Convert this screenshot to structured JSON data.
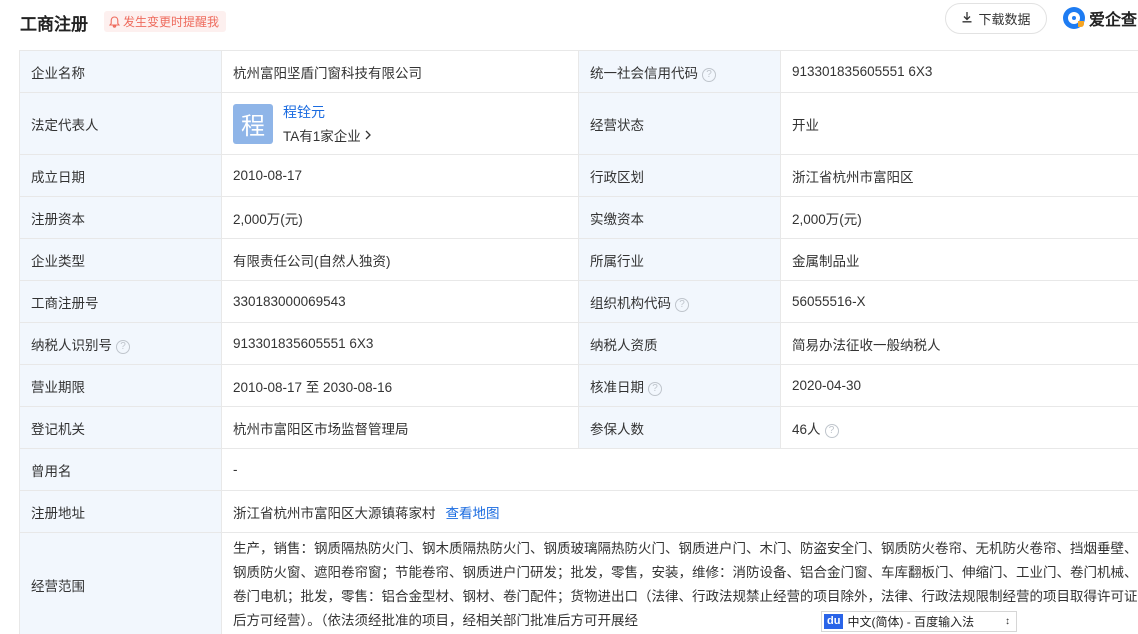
{
  "header": {
    "title": "工商注册",
    "alert_label": "发生变更时提醒我",
    "download_label": "下载数据",
    "brand": "爱企查"
  },
  "rows": {
    "r1": {
      "l1": "企业名称",
      "v1": "杭州富阳坚盾门窗科技有限公司",
      "l2": "统一社会信用代码",
      "v2": "913301835605551 6X3"
    },
    "r2": {
      "l1": "法定代表人",
      "rep_initial": "程",
      "rep_name": "程铨元",
      "rep_link": "TA有1家企业",
      "l2": "经营状态",
      "v2": "开业"
    },
    "r3": {
      "l1": "成立日期",
      "v1": "2010-08-17",
      "l2": "行政区划",
      "v2": "浙江省杭州市富阳区"
    },
    "r4": {
      "l1": "注册资本",
      "v1": "2,000万(元)",
      "l2": "实缴资本",
      "v2": "2,000万(元)"
    },
    "r5": {
      "l1": "企业类型",
      "v1": "有限责任公司(自然人独资)",
      "l2": "所属行业",
      "v2": "金属制品业"
    },
    "r6": {
      "l1": "工商注册号",
      "v1": "330183000069543",
      "l2": "组织机构代码",
      "v2": "56055516-X"
    },
    "r7": {
      "l1": "纳税人识别号",
      "v1": "913301835605551 6X3",
      "l2": "纳税人资质",
      "v2": "简易办法征收一般纳税人"
    },
    "r8": {
      "l1": "营业期限",
      "v1": "2010-08-17 至 2030-08-16",
      "l2": "核准日期",
      "v2": "2020-04-30"
    },
    "r9": {
      "l1": "登记机关",
      "v1": "杭州市富阳区市场监督管理局",
      "l2": "参保人数",
      "v2": "46人"
    },
    "r10": {
      "l1": "曾用名",
      "v1": "-"
    },
    "r11": {
      "l1": "注册地址",
      "v1": "浙江省杭州市富阳区大源镇蒋家村",
      "map_link": "查看地图"
    },
    "r12": {
      "l1": "经营范围",
      "v1": "生产，销售：钢质隔热防火门、钢木质隔热防火门、钢质玻璃隔热防火门、钢质进户门、木门、防盗安全门、钢质防火卷帘、无机防火卷帘、挡烟垂壁、钢质防火窗、遮阳卷帘窗；节能卷帘、钢质进户门研发；批发，零售，安装，维修：消防设备、铝合金门窗、车库翻板门、伸缩门、工业门、卷门机械、卷门电机；批发，零售：铝合金型材、钢材、卷门配件；货物进出口（法律、行政法规禁止经营的项目除外，法律、行政法规限制经营的项目取得许可证后方可经营）。（依法须经批准的项目，经相关部门批准后方可开展经"
    }
  },
  "ime": {
    "logo": "du",
    "label": "中文(简体) - 百度输入法"
  },
  "colors": {
    "label_bg": "#f2f7fd",
    "link": "#1a6be0",
    "alert": "#ee6b5d",
    "brand": "#1e7cf2"
  }
}
